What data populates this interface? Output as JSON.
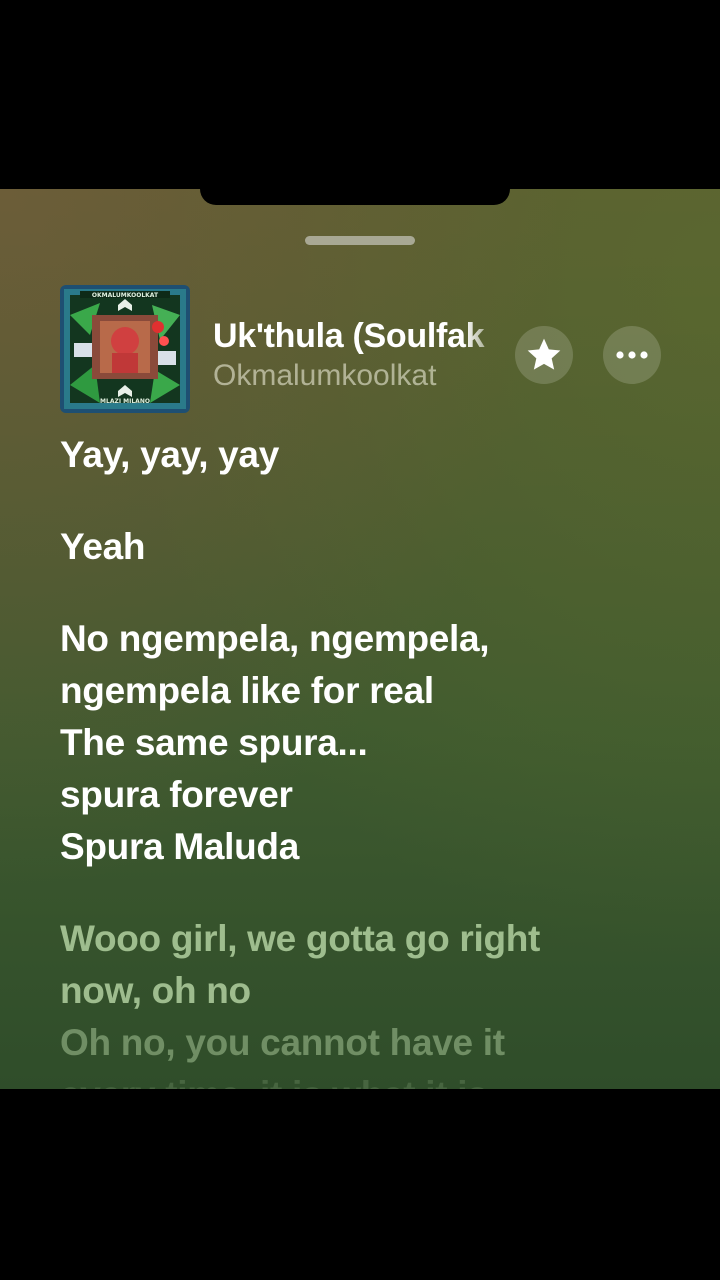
{
  "player": {
    "track_title": "Uk'thula (Soulfak",
    "artist": "Okmalumkoolkat",
    "artwork": {
      "top_text": "OKMALUMKOOLKAT",
      "bottom_text": "MLAZI MILANO"
    },
    "icons": {
      "favorite": "star-icon",
      "more": "more-options-icon"
    }
  },
  "lyrics": {
    "stanzas": [
      {
        "lines": [
          "Yay, yay, yay"
        ]
      },
      {
        "lines": [
          "Yeah"
        ]
      },
      {
        "lines": [
          "No ngempela, ngempela,",
          "ngempela like for real",
          "The same spura...",
          "spura forever",
          "Spura Maluda"
        ]
      },
      {
        "lines": [
          "Wooo girl, we gotta go right",
          "now, oh no",
          "Oh no, you cannot have it",
          "every time, it is what it is"
        ]
      }
    ]
  },
  "colors": {
    "background_top": "#5d5b33",
    "background_bottom": "#2f4d2a",
    "lyric_active": "#ffffff",
    "lyric_upcoming": "#c8e6b4"
  }
}
